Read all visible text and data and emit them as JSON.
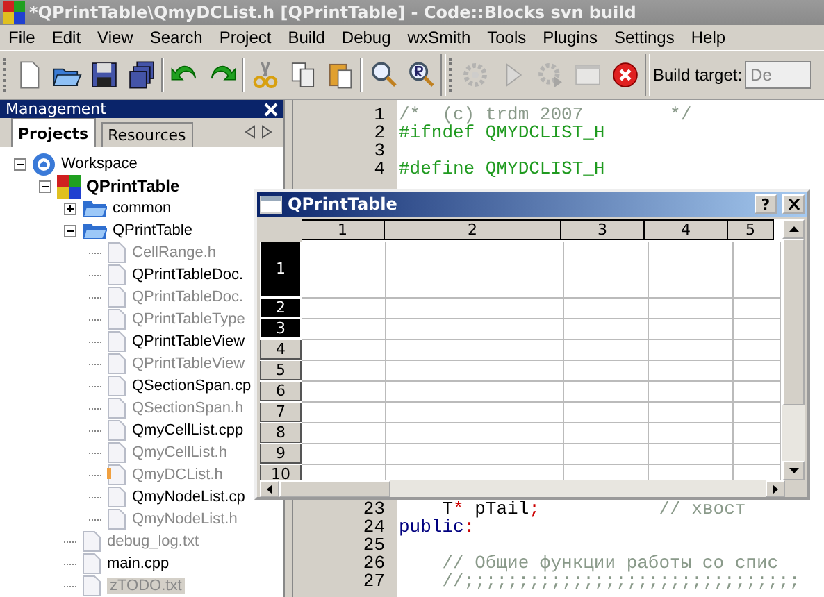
{
  "window": {
    "title": "*QPrintTable\\QmyDCList.h [QPrintTable] - Code::Blocks svn build"
  },
  "menu": [
    "File",
    "Edit",
    "View",
    "Search",
    "Project",
    "Build",
    "Debug",
    "wxSmith",
    "Tools",
    "Plugins",
    "Settings",
    "Help"
  ],
  "toolbar": {
    "buttons": [
      {
        "disabled": false
      },
      {
        "disabled": false
      },
      {
        "disabled": false
      },
      {
        "disabled": false
      },
      {
        "disabled": false
      },
      {
        "disabled": false
      },
      {
        "disabled": false
      },
      {
        "disabled": false
      },
      {
        "disabled": false
      },
      {
        "disabled": false
      },
      {
        "disabled": false
      },
      {
        "disabled": true
      },
      {
        "disabled": true
      },
      {
        "disabled": true
      },
      {
        "disabled": true
      },
      {
        "disabled": false
      }
    ],
    "build_target_label": "Build target:",
    "build_target_value": "De"
  },
  "panel": {
    "title": "Management",
    "tabs": [
      {
        "label": "Projects",
        "selected": true
      },
      {
        "label": "Resources",
        "selected": false
      }
    ],
    "tree": [
      {
        "label": "Workspace",
        "kind": "workspace",
        "expanded": true,
        "children": [
          {
            "label": "QPrintTable",
            "kind": "project",
            "expanded": true,
            "children": [
              {
                "label": "common",
                "kind": "folder",
                "expanded": false
              },
              {
                "label": "QPrintTable",
                "kind": "folder",
                "expanded": true,
                "children": [
                  {
                    "label": "CellRange.h",
                    "kind": "file",
                    "open": false,
                    "modified": false,
                    "selected": false
                  },
                  {
                    "label": "QPrintTableDoc.",
                    "kind": "file",
                    "open": true,
                    "modified": false,
                    "selected": false
                  },
                  {
                    "label": "QPrintTableDoc.",
                    "kind": "file",
                    "open": false,
                    "modified": false,
                    "selected": false
                  },
                  {
                    "label": "QPrintTableType",
                    "kind": "file",
                    "open": false,
                    "modified": false,
                    "selected": false
                  },
                  {
                    "label": "QPrintTableView",
                    "kind": "file",
                    "open": true,
                    "modified": false,
                    "selected": false
                  },
                  {
                    "label": "QPrintTableView",
                    "kind": "file",
                    "open": false,
                    "modified": false,
                    "selected": false
                  },
                  {
                    "label": "QSectionSpan.cp",
                    "kind": "file",
                    "open": true,
                    "modified": false,
                    "selected": false
                  },
                  {
                    "label": "QSectionSpan.h",
                    "kind": "file",
                    "open": false,
                    "modified": false,
                    "selected": false
                  },
                  {
                    "label": "QmyCellList.cpp",
                    "kind": "file",
                    "open": true,
                    "modified": false,
                    "selected": false
                  },
                  {
                    "label": "QmyCellList.h",
                    "kind": "file",
                    "open": false,
                    "modified": false,
                    "selected": false
                  },
                  {
                    "label": "QmyDCList.h",
                    "kind": "file",
                    "open": false,
                    "modified": true,
                    "selected": false
                  },
                  {
                    "label": "QmyNodeList.cp",
                    "kind": "file",
                    "open": true,
                    "modified": false,
                    "selected": false
                  },
                  {
                    "label": "QmyNodeList.h",
                    "kind": "file",
                    "open": false,
                    "modified": false,
                    "selected": false
                  }
                ]
              },
              {
                "label": "debug_log.txt",
                "kind": "file",
                "open": false,
                "modified": false,
                "selected": false
              },
              {
                "label": "main.cpp",
                "kind": "file",
                "open": true,
                "modified": false,
                "selected": false
              },
              {
                "label": "zTODO.txt",
                "kind": "file",
                "open": false,
                "modified": false,
                "selected": true
              }
            ]
          }
        ]
      }
    ]
  },
  "editor": {
    "top_lines": [
      {
        "number": "1",
        "segments": [
          {
            "text": "/*  (c) trdm 2007        */",
            "kind": "comment"
          }
        ]
      },
      {
        "number": "2",
        "segments": [
          {
            "text": "#ifndef QMYDCLIST_H",
            "kind": "preprocessor"
          }
        ]
      },
      {
        "number": "3"
      },
      {
        "number": "4",
        "segments": [
          {
            "text": "#define QMYDCLIST_H",
            "kind": "preprocessor"
          }
        ]
      }
    ],
    "bottom_lines": [
      {
        "number": "23",
        "segments": [
          {
            "text": "    T",
            "kind": "code"
          },
          {
            "text": "*",
            "kind": "operator"
          },
          {
            "text": " pTail",
            "kind": "code"
          },
          {
            "text": ";",
            "kind": "operator"
          },
          {
            "text": "           // хвост",
            "kind": "comment"
          }
        ]
      },
      {
        "number": "24",
        "segments": [
          {
            "text": "public",
            "kind": "keyword"
          },
          {
            "text": ":",
            "kind": "operator"
          }
        ]
      },
      {
        "number": "25"
      },
      {
        "number": "26",
        "segments": [
          {
            "text": "    // Общие функции работы со спис",
            "kind": "comment"
          }
        ]
      },
      {
        "number": "27",
        "segments": [
          {
            "text": "    //;;;;;;;;;;;;;;;;;;;;;;;;;;;;;;;",
            "kind": "comment"
          }
        ]
      }
    ]
  },
  "dialog": {
    "title": "QPrintTable",
    "help_button": "?",
    "columns": [
      "1",
      "2",
      "3",
      "4",
      "5"
    ],
    "rows": [
      {
        "label": "1",
        "selected": true
      },
      {
        "label": "2",
        "selected": true
      },
      {
        "label": "3",
        "selected": true
      },
      {
        "label": "4",
        "selected": false
      },
      {
        "label": "5",
        "selected": false
      },
      {
        "label": "6",
        "selected": false
      },
      {
        "label": "7",
        "selected": false
      },
      {
        "label": "8",
        "selected": false
      },
      {
        "label": "9",
        "selected": false
      },
      {
        "label": "10",
        "selected": false
      }
    ]
  }
}
